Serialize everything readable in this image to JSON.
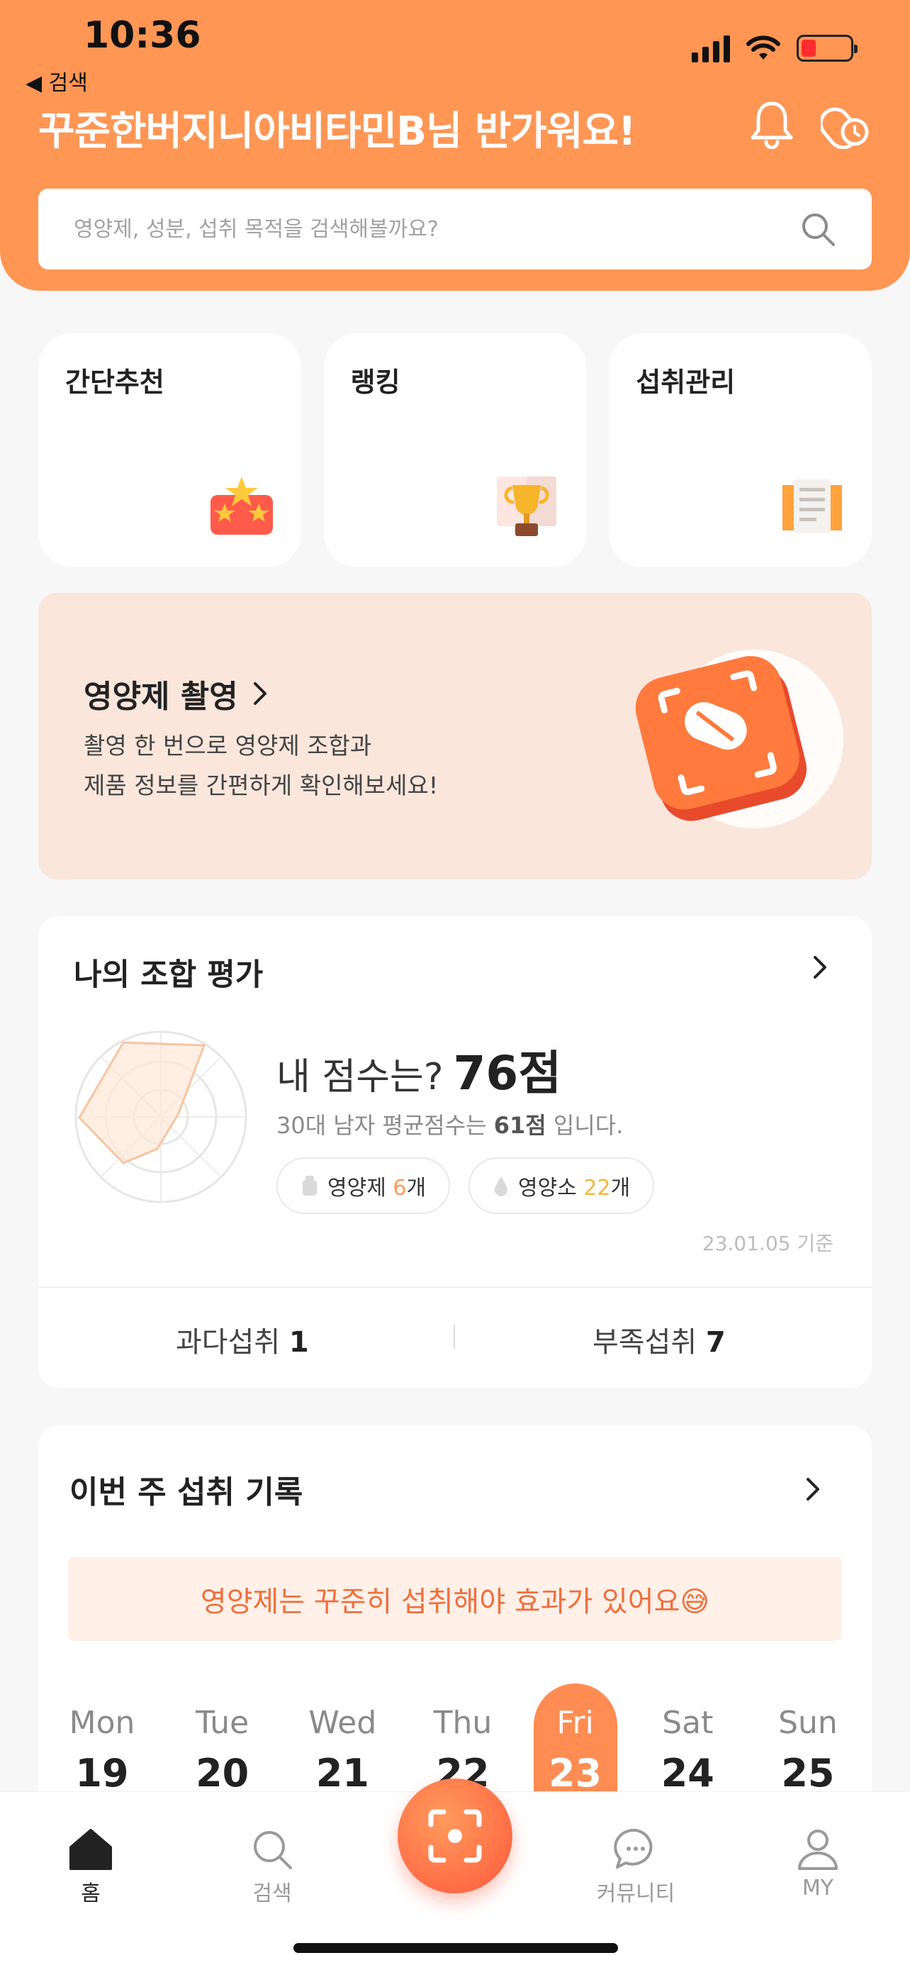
{
  "status_bar": {
    "time": "10:36",
    "back_label": "◀ 검색",
    "battery_level": 0.3
  },
  "header": {
    "greeting": "꾸준한버지니아비타민B님 반가워요!",
    "bell_icon": "bell-icon",
    "pill_clock_icon": "pill-clock-icon"
  },
  "search": {
    "placeholder": "영양제, 성분, 섭취 목적을 검색해볼까요?",
    "value": ""
  },
  "quick_menu": [
    {
      "label": "간단추천",
      "icon": "stars-icon"
    },
    {
      "label": "랭킹",
      "icon": "trophy-icon"
    },
    {
      "label": "섭취관리",
      "icon": "notebook-icon"
    }
  ],
  "banner": {
    "title": "영양제 촬영",
    "desc_line1": "촬영 한 번으로 영양제 조합과",
    "desc_line2": "제품 정보를 간편하게 확인해보세요!"
  },
  "score_card": {
    "title": "나의 조합 평가",
    "score_question": "내 점수는?",
    "score_value": "76점",
    "avg_prefix": "30대 남자 평균점수는 ",
    "avg_value": "61점",
    "avg_suffix": " 입니다.",
    "supplement_chip": {
      "label": "영양제 ",
      "count": "6",
      "unit": "개"
    },
    "nutrient_chip": {
      "label": "영양소 ",
      "count": "22",
      "unit": "개"
    },
    "as_of": "23.01.05  기준",
    "over_label": "과다섭취 ",
    "over_count": "1",
    "under_label": "부족섭취 ",
    "under_count": "7"
  },
  "week_card": {
    "title": "이번 주 섭취 기록",
    "notice": "영양제는 꾸준히 섭취해야 효과가 있어요😅",
    "days": [
      {
        "name": "Mon",
        "num": "19"
      },
      {
        "name": "Tue",
        "num": "20"
      },
      {
        "name": "Wed",
        "num": "21"
      },
      {
        "name": "Thu",
        "num": "22"
      },
      {
        "name": "Fri",
        "num": "23"
      },
      {
        "name": "Sat",
        "num": "24"
      },
      {
        "name": "Sun",
        "num": "25"
      }
    ],
    "active_day": "Fri"
  },
  "tabbar": {
    "home": "홈",
    "search": "검색",
    "community": "커뮤니티",
    "my": "MY"
  },
  "colors": {
    "brand": "#ff9654",
    "accent": "#ff5a3c",
    "banner_bg": "#fbe6dc"
  }
}
